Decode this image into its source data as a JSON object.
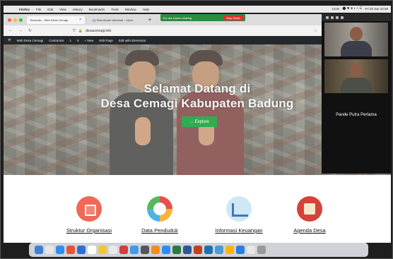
{
  "menubar": {
    "items": [
      "Firefox",
      "File",
      "Edit",
      "View",
      "History",
      "Bookmarks",
      "Tools",
      "Window",
      "Help"
    ],
    "zoom_label": "zoom",
    "clock": "Fri 20 Jun 10.59"
  },
  "share_bar": {
    "text": "You are screen sharing",
    "stop": "Stop Share"
  },
  "tabs": [
    {
      "label": "Beranda – Web Desa Cemagi"
    },
    {
      "label": "(1) Roundcube Webmail :: Inbox"
    }
  ],
  "url": {
    "value": "desacemagi.info"
  },
  "wp_bar": {
    "items": [
      "Web Desa Cemagi",
      "Customize",
      "1",
      "0",
      "+ New",
      "Edit Page",
      "Edit with Elementor"
    ]
  },
  "hero": {
    "title_line1": "Selamat Datang di",
    "title_line2": "Desa Cemagi Kabupaten Badung",
    "button": "→ Explore"
  },
  "features": [
    {
      "label": "Struktur Organisasi",
      "icon": "org-chart-icon"
    },
    {
      "label": "Data Penduduk",
      "icon": "pie-chart-icon"
    },
    {
      "label": "Informasi Keuangan",
      "icon": "finance-chart-icon"
    },
    {
      "label": "Agenda Desa",
      "icon": "agenda-icon"
    }
  ],
  "video": {
    "participant_name": "Pande Putra Pertama"
  },
  "colors": {
    "explore_green": "#2fae4f",
    "share_green": "#2e8b3f",
    "wp_bar": "#23282d"
  }
}
